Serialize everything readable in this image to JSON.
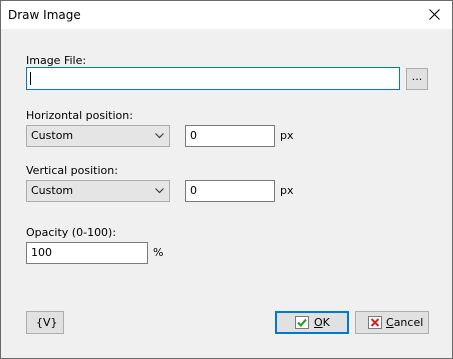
{
  "window": {
    "title": "Draw Image"
  },
  "image_file": {
    "label": "Image File:",
    "value": "",
    "browse_label": "..."
  },
  "horizontal": {
    "label": "Horizontal position:",
    "selected": "Custom",
    "value": "0",
    "unit": "px"
  },
  "vertical": {
    "label": "Vertical position:",
    "selected": "Custom",
    "value": "0",
    "unit": "px"
  },
  "opacity": {
    "label": "Opacity (0-100):",
    "value": "100",
    "unit": "%"
  },
  "footer": {
    "variables_label": "{V}",
    "ok_label": "OK",
    "cancel_label": "Cancel"
  },
  "colors": {
    "accent": "#0078d7",
    "ok_check": "#2e9e2e",
    "cancel_x": "#d42020"
  },
  "icons": {
    "close": "close-icon",
    "combo_arrow": "chevron-down-icon",
    "ok": "checkmark-icon",
    "cancel": "cancel-x-icon"
  }
}
